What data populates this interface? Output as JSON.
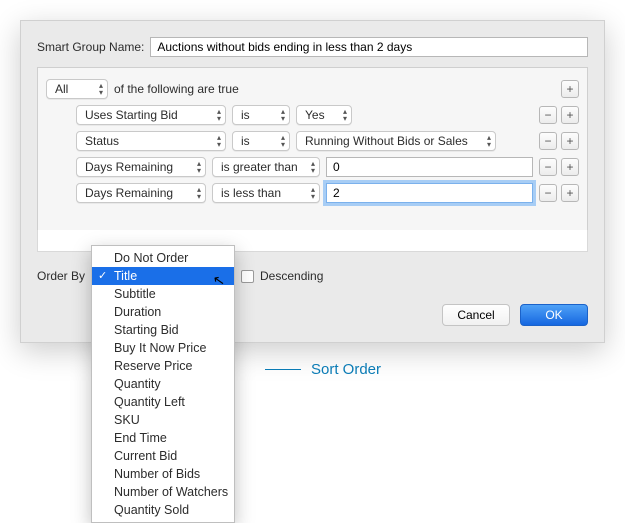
{
  "header": {
    "name_label": "Smart Group Name:",
    "name_value": "Auctions without bids ending in less than 2 days"
  },
  "all_row": {
    "match": "All",
    "suffix": "of the following are true"
  },
  "rules": [
    {
      "field": "Uses Starting Bid",
      "op": "is",
      "value_select": "Yes"
    },
    {
      "field": "Status",
      "op": "is",
      "value_select": "Running Without Bids or Sales"
    },
    {
      "field": "Days Remaining",
      "op": "is greater than",
      "value_text": "0"
    },
    {
      "field": "Days Remaining",
      "op": "is less than",
      "value_text": "2",
      "focused": true
    }
  ],
  "order": {
    "label": "Order By",
    "selected": "Title",
    "descending_label": "Descending",
    "options": [
      "Do Not Order",
      "Title",
      "Subtitle",
      "Duration",
      "Starting Bid",
      "Buy It Now Price",
      "Reserve Price",
      "Quantity",
      "Quantity Left",
      "SKU",
      "End Time",
      "Current Bid",
      "Number of Bids",
      "Number of Watchers",
      "Quantity Sold"
    ]
  },
  "footer": {
    "cancel": "Cancel",
    "ok": "OK"
  },
  "callout": {
    "sort": "Sort Order"
  }
}
